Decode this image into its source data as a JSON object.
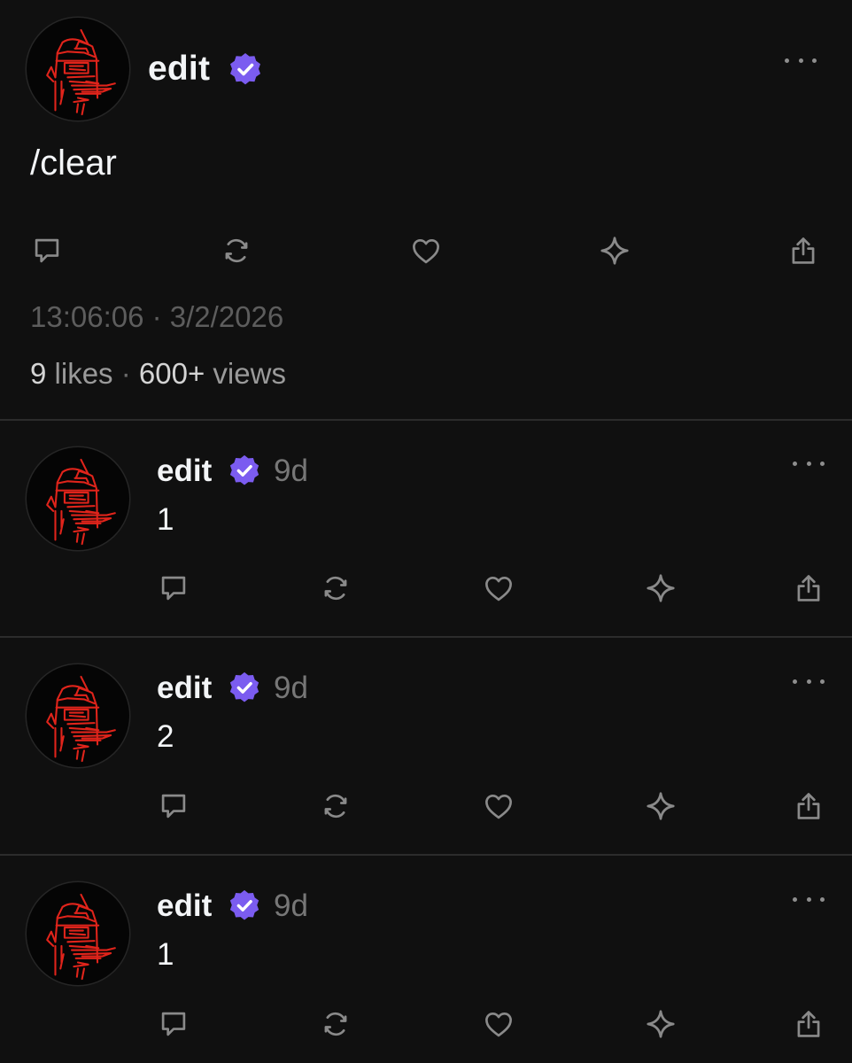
{
  "main_post": {
    "username": "edit",
    "verified": true,
    "body": "/clear",
    "timestamp": "13:06:06 · 3/2/2026",
    "likes_count": "9",
    "likes_label": "likes",
    "stats_separator": "·",
    "views_count": "600+",
    "views_label": "views",
    "actions": [
      "comment-icon",
      "repost-icon",
      "heart-icon",
      "sparkle-icon",
      "share-icon"
    ]
  },
  "replies": [
    {
      "username": "edit",
      "verified": true,
      "age": "9d",
      "body": "1"
    },
    {
      "username": "edit",
      "verified": true,
      "age": "9d",
      "body": "2"
    },
    {
      "username": "edit",
      "verified": true,
      "age": "9d",
      "body": "1"
    }
  ],
  "colors": {
    "background": "#101010",
    "text_primary": "#f3f5f7",
    "text_muted": "#777777",
    "verified_badge": "#7b5cf0",
    "avatar_drawing": "#e0241b",
    "divider": "#2c2c2c"
  }
}
